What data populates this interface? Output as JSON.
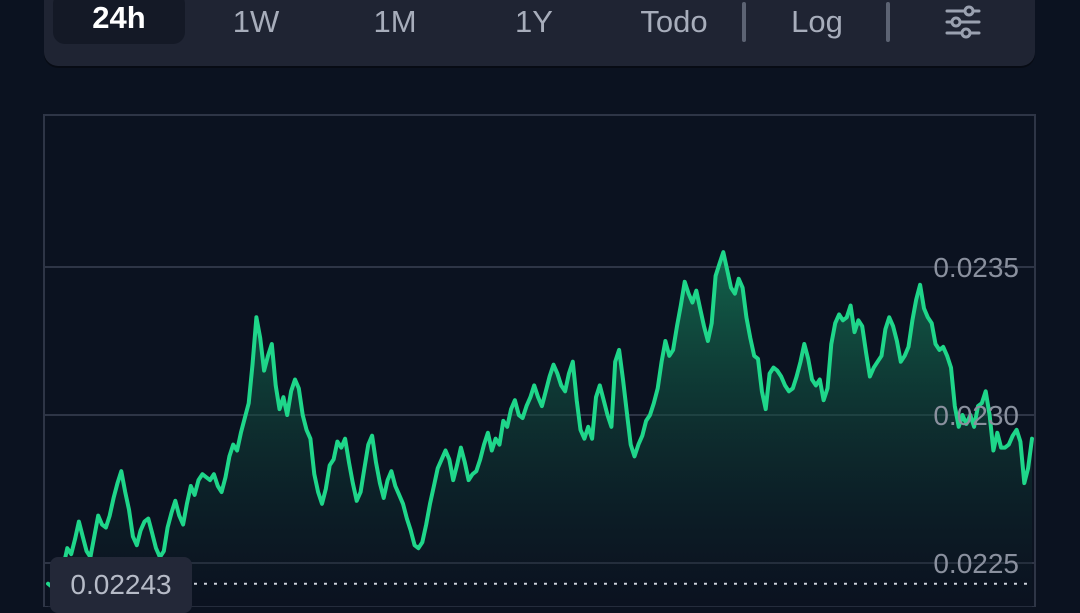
{
  "toolbar": {
    "ranges": [
      {
        "label": "24h",
        "active": true
      },
      {
        "label": "1W",
        "active": false
      },
      {
        "label": "1M",
        "active": false
      },
      {
        "label": "1Y",
        "active": false
      },
      {
        "label": "Todo",
        "active": false
      }
    ],
    "log_label": "Log",
    "filter_icon": "sliders-icon"
  },
  "colors": {
    "background": "#0b1220",
    "line": "#1fd68a",
    "area_top": "#15805a",
    "grid": "#2e3546",
    "toolbar_bg": "#1f2433"
  },
  "current_price_label": "0.02243",
  "chart_data": {
    "type": "area",
    "y_ticks": [
      {
        "value": 0.0235,
        "label": "0.0235"
      },
      {
        "value": 0.023,
        "label": "0.0230"
      },
      {
        "value": 0.0225,
        "label": "0.0225"
      }
    ],
    "ylim": [
      0.02238,
      0.024
    ],
    "reference_line": 0.02243,
    "grid": true,
    "values": [
      0.02243,
      0.02242,
      0.02244,
      0.02246,
      0.02249,
      0.02255,
      0.02253,
      0.02258,
      0.02264,
      0.02259,
      0.02254,
      0.02252,
      0.02259,
      0.02266,
      0.02263,
      0.02262,
      0.02266,
      0.02272,
      0.02277,
      0.02281,
      0.02274,
      0.02268,
      0.02259,
      0.02256,
      0.02261,
      0.02264,
      0.02265,
      0.0226,
      0.02255,
      0.02252,
      0.02254,
      0.02262,
      0.02267,
      0.02271,
      0.02266,
      0.02263,
      0.0227,
      0.02276,
      0.02273,
      0.02278,
      0.0228,
      0.02279,
      0.02278,
      0.0228,
      0.02276,
      0.02274,
      0.02279,
      0.02286,
      0.0229,
      0.02288,
      0.02294,
      0.02299,
      0.02304,
      0.02317,
      0.02333,
      0.02326,
      0.02315,
      0.0232,
      0.02324,
      0.0231,
      0.02302,
      0.02306,
      0.023,
      0.02308,
      0.02312,
      0.02309,
      0.023,
      0.02295,
      0.02292,
      0.0228,
      0.02274,
      0.0227,
      0.02275,
      0.02283,
      0.02285,
      0.02291,
      0.02289,
      0.02292,
      0.02284,
      0.02277,
      0.02271,
      0.02274,
      0.02282,
      0.0229,
      0.02293,
      0.02284,
      0.02277,
      0.02272,
      0.02278,
      0.02281,
      0.02276,
      0.02273,
      0.0227,
      0.02265,
      0.02261,
      0.02256,
      0.02255,
      0.02257,
      0.02263,
      0.0227,
      0.02276,
      0.02282,
      0.02285,
      0.02288,
      0.02285,
      0.02278,
      0.02283,
      0.02289,
      0.02284,
      0.02278,
      0.0228,
      0.02281,
      0.02285,
      0.0229,
      0.02294,
      0.02288,
      0.02292,
      0.0229,
      0.02298,
      0.02296,
      0.02302,
      0.02305,
      0.023,
      0.02299,
      0.02303,
      0.02306,
      0.0231,
      0.02306,
      0.02303,
      0.02308,
      0.02313,
      0.02317,
      0.02314,
      0.0231,
      0.02308,
      0.02314,
      0.02318,
      0.02305,
      0.02295,
      0.02292,
      0.02296,
      0.02292,
      0.02306,
      0.0231,
      0.02305,
      0.023,
      0.02296,
      0.02318,
      0.02322,
      0.02312,
      0.02301,
      0.0229,
      0.02286,
      0.0229,
      0.02293,
      0.02298,
      0.023,
      0.02304,
      0.02309,
      0.02318,
      0.02325,
      0.0232,
      0.02322,
      0.0233,
      0.02337,
      0.02345,
      0.02341,
      0.02338,
      0.02342,
      0.02336,
      0.0233,
      0.02325,
      0.02331,
      0.02347,
      0.02351,
      0.02355,
      0.02349,
      0.02343,
      0.02341,
      0.02346,
      0.02343,
      0.02333,
      0.02326,
      0.0232,
      0.02319,
      0.02308,
      0.02302,
      0.02314,
      0.02316,
      0.02315,
      0.02313,
      0.0231,
      0.02308,
      0.02309,
      0.02313,
      0.02318,
      0.02324,
      0.02319,
      0.02312,
      0.0231,
      0.02312,
      0.02305,
      0.02309,
      0.02324,
      0.02331,
      0.02334,
      0.02332,
      0.02333,
      0.02337,
      0.02328,
      0.02332,
      0.0233,
      0.02321,
      0.02313,
      0.02316,
      0.02318,
      0.0232,
      0.02329,
      0.02333,
      0.0233,
      0.02325,
      0.02318,
      0.0232,
      0.02323,
      0.02332,
      0.02339,
      0.02344,
      0.02336,
      0.02333,
      0.02331,
      0.02324,
      0.02322,
      0.02323,
      0.0232,
      0.02316,
      0.02303,
      0.02296,
      0.023,
      0.02297,
      0.023,
      0.02296,
      0.02303,
      0.02304,
      0.02308,
      0.023,
      0.02288,
      0.02294,
      0.02289,
      0.02289,
      0.0229,
      0.02293,
      0.02295,
      0.02291,
      0.02277,
      0.02282,
      0.02292
    ]
  }
}
